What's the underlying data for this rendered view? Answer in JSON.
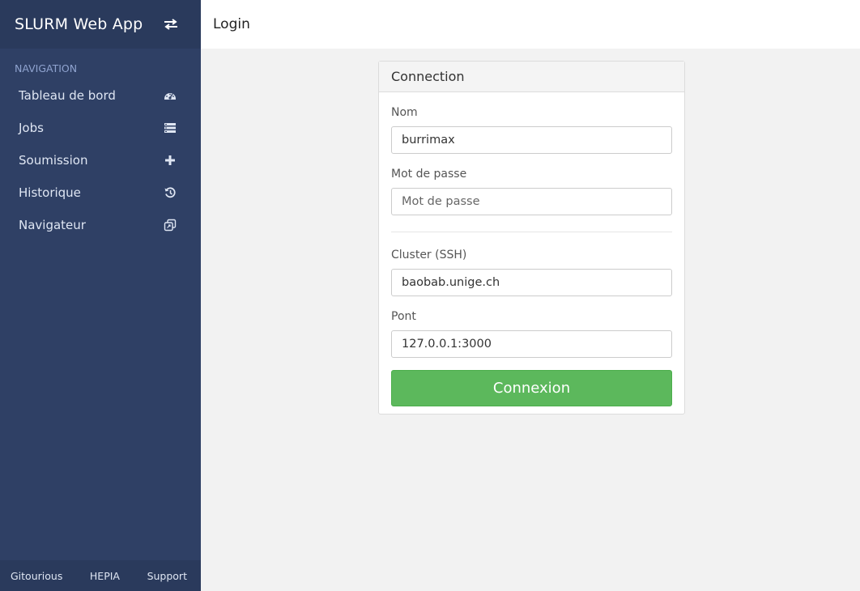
{
  "app": {
    "title": "SLURM Web App"
  },
  "sidebar": {
    "heading": "NAVIGATION",
    "items": [
      {
        "label": "Tableau de bord",
        "icon": "dashboard-icon"
      },
      {
        "label": "Jobs",
        "icon": "list-icon"
      },
      {
        "label": "Soumission",
        "icon": "plus-icon"
      },
      {
        "label": "Historique",
        "icon": "history-icon"
      },
      {
        "label": "Navigateur",
        "icon": "browser-icon"
      }
    ],
    "footer": [
      "Gitourious",
      "HEPIA",
      "Support"
    ]
  },
  "header": {
    "title": "Login"
  },
  "login_panel": {
    "title": "Connection",
    "fields": {
      "name": {
        "label": "Nom",
        "value": "burrimax",
        "placeholder": ""
      },
      "password": {
        "label": "Mot de passe",
        "value": "",
        "placeholder": "Mot de passe"
      },
      "cluster": {
        "label": "Cluster (SSH)",
        "value": "baobab.unige.ch",
        "placeholder": ""
      },
      "port": {
        "label": "Pont",
        "value": "127.0.0.1:3000",
        "placeholder": ""
      }
    },
    "submit_label": "Connexion"
  },
  "colors": {
    "sidebar_bg": "#2f4065",
    "sidebar_header_bg": "#2a3a5c",
    "nav_heading": "#8fa3cf",
    "success": "#5cb85c"
  }
}
